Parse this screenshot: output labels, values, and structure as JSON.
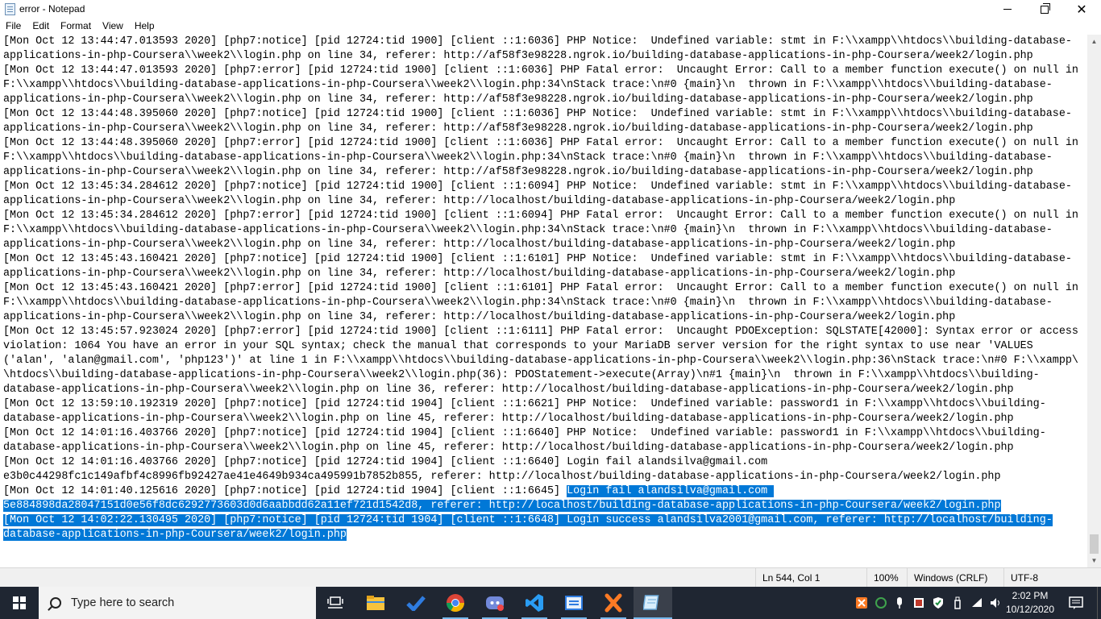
{
  "window": {
    "title": "error - Notepad",
    "minimize_label": "",
    "maximize_label": "",
    "close_label": "✕"
  },
  "menu": [
    "File",
    "Edit",
    "Format",
    "View",
    "Help"
  ],
  "editor": {
    "lines": [
      {
        "text": "[Mon Oct 12 13:44:47.013593 2020] [php7:notice] [pid 12724:tid 1900] [client ::1:6036] PHP Notice:  Undefined variable: stmt in F:\\\\xampp\\\\htdocs\\\\building-database-",
        "sel": ""
      },
      {
        "text": "applications-in-php-Coursera\\\\week2\\\\login.php on line 34, referer: http://af58f3e98228.ngrok.io/building-database-applications-in-php-Coursera/week2/login.php",
        "sel": ""
      },
      {
        "text": "[Mon Oct 12 13:44:47.013593 2020] [php7:error] [pid 12724:tid 1900] [client ::1:6036] PHP Fatal error:  Uncaught Error: Call to a member function execute() on null in",
        "sel": ""
      },
      {
        "text": "F:\\\\xampp\\\\htdocs\\\\building-database-applications-in-php-Coursera\\\\week2\\\\login.php:34\\nStack trace:\\n#0 {main}\\n  thrown in F:\\\\xampp\\\\htdocs\\\\building-database-",
        "sel": ""
      },
      {
        "text": "applications-in-php-Coursera\\\\week2\\\\login.php on line 34, referer: http://af58f3e98228.ngrok.io/building-database-applications-in-php-Coursera/week2/login.php",
        "sel": ""
      },
      {
        "text": "[Mon Oct 12 13:44:48.395060 2020] [php7:notice] [pid 12724:tid 1900] [client ::1:6036] PHP Notice:  Undefined variable: stmt in F:\\\\xampp\\\\htdocs\\\\building-database-",
        "sel": ""
      },
      {
        "text": "applications-in-php-Coursera\\\\week2\\\\login.php on line 34, referer: http://af58f3e98228.ngrok.io/building-database-applications-in-php-Coursera/week2/login.php",
        "sel": ""
      },
      {
        "text": "[Mon Oct 12 13:44:48.395060 2020] [php7:error] [pid 12724:tid 1900] [client ::1:6036] PHP Fatal error:  Uncaught Error: Call to a member function execute() on null in",
        "sel": ""
      },
      {
        "text": "F:\\\\xampp\\\\htdocs\\\\building-database-applications-in-php-Coursera\\\\week2\\\\login.php:34\\nStack trace:\\n#0 {main}\\n  thrown in F:\\\\xampp\\\\htdocs\\\\building-database-",
        "sel": ""
      },
      {
        "text": "applications-in-php-Coursera\\\\week2\\\\login.php on line 34, referer: http://af58f3e98228.ngrok.io/building-database-applications-in-php-Coursera/week2/login.php",
        "sel": ""
      },
      {
        "text": "[Mon Oct 12 13:45:34.284612 2020] [php7:notice] [pid 12724:tid 1900] [client ::1:6094] PHP Notice:  Undefined variable: stmt in F:\\\\xampp\\\\htdocs\\\\building-database-",
        "sel": ""
      },
      {
        "text": "applications-in-php-Coursera\\\\week2\\\\login.php on line 34, referer: http://localhost/building-database-applications-in-php-Coursera/week2/login.php",
        "sel": ""
      },
      {
        "text": "[Mon Oct 12 13:45:34.284612 2020] [php7:error] [pid 12724:tid 1900] [client ::1:6094] PHP Fatal error:  Uncaught Error: Call to a member function execute() on null in",
        "sel": ""
      },
      {
        "text": "F:\\\\xampp\\\\htdocs\\\\building-database-applications-in-php-Coursera\\\\week2\\\\login.php:34\\nStack trace:\\n#0 {main}\\n  thrown in F:\\\\xampp\\\\htdocs\\\\building-database-",
        "sel": ""
      },
      {
        "text": "applications-in-php-Coursera\\\\week2\\\\login.php on line 34, referer: http://localhost/building-database-applications-in-php-Coursera/week2/login.php",
        "sel": ""
      },
      {
        "text": "[Mon Oct 12 13:45:43.160421 2020] [php7:notice] [pid 12724:tid 1900] [client ::1:6101] PHP Notice:  Undefined variable: stmt in F:\\\\xampp\\\\htdocs\\\\building-database-",
        "sel": ""
      },
      {
        "text": "applications-in-php-Coursera\\\\week2\\\\login.php on line 34, referer: http://localhost/building-database-applications-in-php-Coursera/week2/login.php",
        "sel": ""
      },
      {
        "text": "[Mon Oct 12 13:45:43.160421 2020] [php7:error] [pid 12724:tid 1900] [client ::1:6101] PHP Fatal error:  Uncaught Error: Call to a member function execute() on null in",
        "sel": ""
      },
      {
        "text": "F:\\\\xampp\\\\htdocs\\\\building-database-applications-in-php-Coursera\\\\week2\\\\login.php:34\\nStack trace:\\n#0 {main}\\n  thrown in F:\\\\xampp\\\\htdocs\\\\building-database-",
        "sel": ""
      },
      {
        "text": "applications-in-php-Coursera\\\\week2\\\\login.php on line 34, referer: http://localhost/building-database-applications-in-php-Coursera/week2/login.php",
        "sel": ""
      },
      {
        "text": "[Mon Oct 12 13:45:57.923024 2020] [php7:error] [pid 12724:tid 1900] [client ::1:6111] PHP Fatal error:  Uncaught PDOException: SQLSTATE[42000]: Syntax error or access",
        "sel": ""
      },
      {
        "text": "violation: 1064 You have an error in your SQL syntax; check the manual that corresponds to your MariaDB server version for the right syntax to use near 'VALUES",
        "sel": ""
      },
      {
        "text": "('alan', 'alan@gmail.com', 'php123')' at line 1 in F:\\\\xampp\\\\htdocs\\\\building-database-applications-in-php-Coursera\\\\week2\\\\login.php:36\\nStack trace:\\n#0 F:\\\\xampp\\",
        "sel": ""
      },
      {
        "text": "\\htdocs\\\\building-database-applications-in-php-Coursera\\\\week2\\\\login.php(36): PDOStatement->execute(Array)\\n#1 {main}\\n  thrown in F:\\\\xampp\\\\htdocs\\\\building-",
        "sel": ""
      },
      {
        "text": "database-applications-in-php-Coursera\\\\week2\\\\login.php on line 36, referer: http://localhost/building-database-applications-in-php-Coursera/week2/login.php",
        "sel": ""
      },
      {
        "text": "[Mon Oct 12 13:59:10.192319 2020] [php7:notice] [pid 12724:tid 1904] [client ::1:6621] PHP Notice:  Undefined variable: password1 in F:\\\\xampp\\\\htdocs\\\\building-",
        "sel": ""
      },
      {
        "text": "database-applications-in-php-Coursera\\\\week2\\\\login.php on line 45, referer: http://localhost/building-database-applications-in-php-Coursera/week2/login.php",
        "sel": ""
      },
      {
        "text": "[Mon Oct 12 14:01:16.403766 2020] [php7:notice] [pid 12724:tid 1904] [client ::1:6640] PHP Notice:  Undefined variable: password1 in F:\\\\xampp\\\\htdocs\\\\building-",
        "sel": ""
      },
      {
        "text": "database-applications-in-php-Coursera\\\\week2\\\\login.php on line 45, referer: http://localhost/building-database-applications-in-php-Coursera/week2/login.php",
        "sel": ""
      },
      {
        "text": "[Mon Oct 12 14:01:16.403766 2020] [php7:notice] [pid 12724:tid 1904] [client ::1:6640] Login fail alandsilva@gmail.com",
        "sel": ""
      },
      {
        "text": "e3b0c44298fc1c149afbf4c8996fb92427ae41e4649b934ca495991b7852b855, referer: http://localhost/building-database-applications-in-php-Coursera/week2/login.php",
        "sel": ""
      },
      {
        "text": "[Mon Oct 12 14:01:40.125616 2020] [php7:notice] [pid 12724:tid 1904] [client ::1:6645] ",
        "sel": "Login fail alandsilva@gmail.com "
      },
      {
        "text": "",
        "sel": "5e884898da28047151d0e56f8dc6292773603d0d6aabbdd62a11ef721d1542d8, referer: http://localhost/building-database-applications-in-php-Coursera/week2/login.php"
      },
      {
        "text": "",
        "sel": "[Mon Oct 12 14:02:22.130495 2020] [php7:notice] [pid 12724:tid 1904] [client ::1:6648] Login success alandsilva2001@gmail.com, referer: http://localhost/building-"
      },
      {
        "text": "",
        "sel": "database-applications-in-php-Coursera/week2/login.php"
      }
    ]
  },
  "status": {
    "position": "Ln 544, Col 1",
    "zoom": "100%",
    "line_ending": "Windows (CRLF)",
    "encoding": "UTF-8"
  },
  "taskbar": {
    "search_placeholder": "Type here to search",
    "time": "2:02 PM",
    "date": "10/12/2020",
    "apps": [
      {
        "name": "task-view-icon"
      },
      {
        "name": "file-explorer-icon"
      },
      {
        "name": "todo-icon"
      },
      {
        "name": "chrome-icon"
      },
      {
        "name": "discord-icon"
      },
      {
        "name": "vscode-icon"
      },
      {
        "name": "app-window-icon"
      },
      {
        "name": "xampp-icon"
      },
      {
        "name": "notepad-icon"
      }
    ]
  },
  "colors": {
    "selection": "#0078d7",
    "taskbar": "#1f2632",
    "accent": "#76b9ed"
  }
}
